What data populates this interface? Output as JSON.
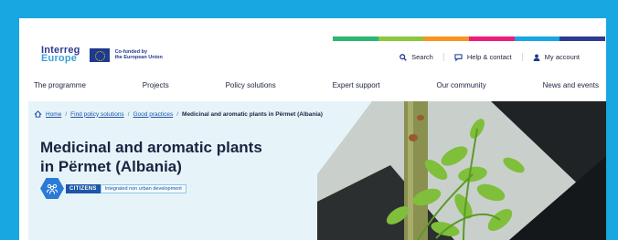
{
  "colors": {
    "frame": "#18a7e0",
    "brand_dark": "#2d3b8f",
    "brand_light": "#3aa1db",
    "hero_bg": "#e6f4fa",
    "colorbar": [
      "#2bb673",
      "#8dc63f",
      "#f7941d",
      "#ed1c79",
      "#18a7e0",
      "#2d3b8f"
    ]
  },
  "header": {
    "logo_line1": "Interreg",
    "logo_line2": "Europe",
    "cofunded_line1": "Co-funded by",
    "cofunded_line2": "the European Union",
    "search_label": "Search",
    "search_icon": "search-icon",
    "help_label": "Help & contact",
    "help_icon": "chat-icon",
    "account_label": "My account",
    "account_icon": "user-icon"
  },
  "nav": {
    "items": [
      {
        "label": "The programme"
      },
      {
        "label": "Projects"
      },
      {
        "label": "Policy solutions"
      },
      {
        "label": "Expert support"
      },
      {
        "label": "Our community"
      },
      {
        "label": "News and events"
      }
    ]
  },
  "breadcrumb": {
    "home": "Home",
    "find": "Find policy solutions",
    "good": "Good practices",
    "current": "Medicinal and aromatic plants in Përmet (Albania)"
  },
  "hero": {
    "title_line1": "Medicinal and aromatic plants",
    "title_line2": "in Përmet (Albania)",
    "tag_icon": "citizens-icon",
    "tag_label": "CITIZENS",
    "tag_sub": "Integrated non urban development"
  }
}
